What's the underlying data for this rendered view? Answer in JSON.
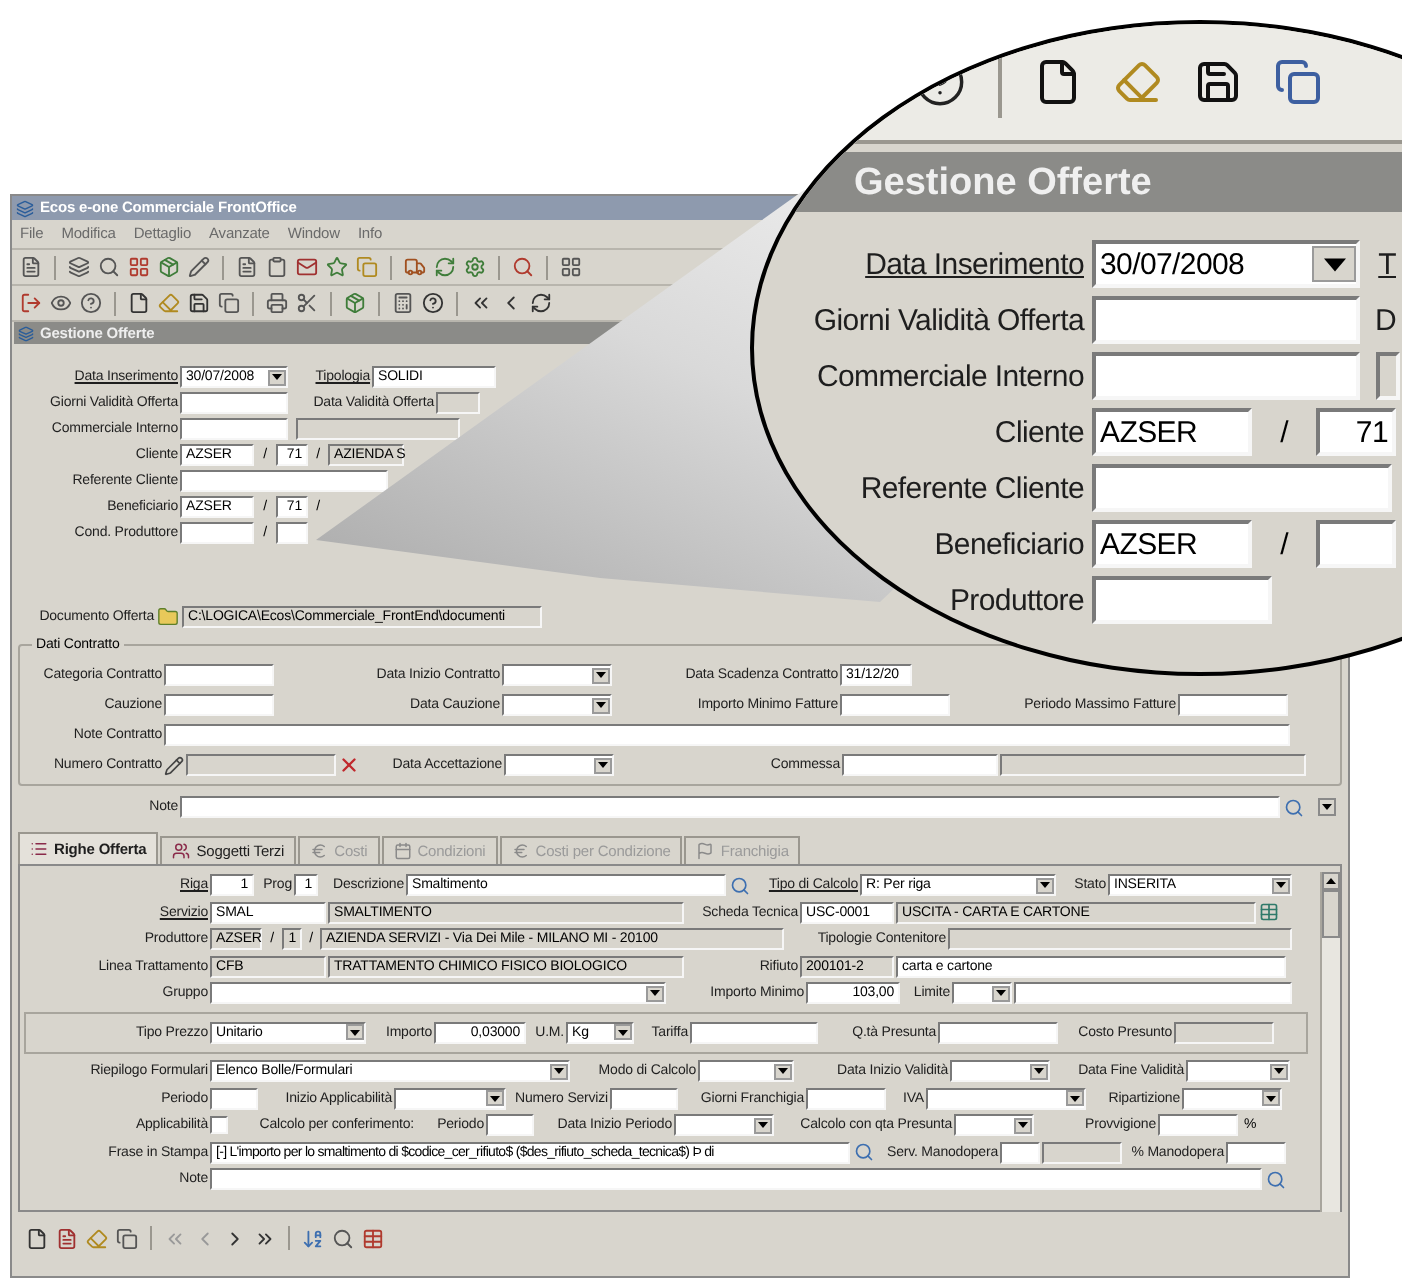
{
  "app": {
    "title": "Ecos e-one Commerciale FrontOffice",
    "menu": [
      "File",
      "Modifica",
      "Dettaglio",
      "Avanzate",
      "Window",
      "Info"
    ]
  },
  "document": {
    "title": "Gestione Offerte",
    "header_rows": [
      [
        {
          "kind": "link",
          "text": "Data Inserimento"
        },
        {
          "kind": "combo",
          "value": "30/07/2008"
        },
        {
          "kind": "link",
          "text": "Tipologia"
        },
        {
          "kind": "field",
          "value": "SOLIDI",
          "disabled": false
        }
      ],
      [
        {
          "kind": "label",
          "text": "Giorni Validità Offerta"
        },
        {
          "kind": "field",
          "disabled": false
        },
        {
          "kind": "label",
          "text": "Data Validità Offerta"
        },
        {
          "kind": "field",
          "disabled": true
        }
      ],
      [
        {
          "kind": "label",
          "text": "Commerciale Interno"
        },
        {
          "kind": "field",
          "disabled": false
        },
        {
          "kind": "field",
          "disabled": true
        }
      ],
      [
        {
          "kind": "label",
          "text": "Cliente"
        },
        {
          "kind": "field",
          "value": "AZSER",
          "disabled": false
        },
        {
          "kind": "text",
          "text": "/"
        },
        {
          "kind": "field",
          "value": "71",
          "disabled": false
        },
        {
          "kind": "text",
          "text": "/"
        },
        {
          "kind": "field",
          "value": "AZIENDA S",
          "disabled": true
        }
      ],
      [
        {
          "kind": "label",
          "text": "Referente Cliente"
        },
        {
          "kind": "field",
          "disabled": false
        }
      ],
      [
        {
          "kind": "label",
          "text": "Beneficiario"
        },
        {
          "kind": "field",
          "value": "AZSER",
          "disabled": false
        },
        {
          "kind": "text",
          "text": "/"
        },
        {
          "kind": "field",
          "value": "71",
          "disabled": false
        },
        {
          "kind": "text",
          "text": "/"
        }
      ],
      [
        {
          "kind": "label",
          "text": "Cond. Produttore"
        },
        {
          "kind": "field",
          "disabled": false
        },
        {
          "kind": "text",
          "text": "/"
        },
        {
          "kind": "field",
          "disabled": false
        }
      ]
    ],
    "document_row": [
      {
        "kind": "label",
        "text": "Documento Offerta"
      },
      {
        "kind": "folder"
      },
      {
        "kind": "field",
        "value": "C:\\LOGICA\\Ecos\\Commerciale_FrontEnd\\documenti",
        "disabled": true
      }
    ],
    "contract": {
      "title": "Dati Contratto",
      "rows": [
        [
          {
            "kind": "label",
            "text": "Categoria Contratto"
          },
          {
            "kind": "field",
            "disabled": false
          },
          {
            "kind": "label",
            "text": "Data Inizio Contratto"
          },
          {
            "kind": "combo"
          },
          {
            "kind": "label",
            "text": "Data Scadenza Contratto"
          },
          {
            "kind": "field",
            "value": "31/12/20",
            "disabled": false
          }
        ],
        [
          {
            "kind": "label",
            "text": "Cauzione"
          },
          {
            "kind": "field",
            "disabled": false
          },
          {
            "kind": "label",
            "text": "Data Cauzione"
          },
          {
            "kind": "combo"
          },
          {
            "kind": "label",
            "text": "Importo Minimo Fatture"
          },
          {
            "kind": "field",
            "disabled": false
          },
          {
            "kind": "label",
            "text": "Periodo Massimo Fatture"
          },
          {
            "kind": "field",
            "disabled": false
          }
        ],
        [
          {
            "kind": "label",
            "text": "Note Contratto"
          },
          {
            "kind": "field",
            "disabled": false
          }
        ],
        [
          {
            "kind": "label",
            "text": "Numero Contratto"
          },
          {
            "kind": "number_picker",
            "disabled": true
          },
          {
            "kind": "label",
            "text": "Data Accettazione"
          },
          {
            "kind": "combo"
          },
          {
            "kind": "label",
            "text": "Commessa"
          },
          {
            "kind": "field",
            "disabled": false
          },
          {
            "kind": "field",
            "disabled": true
          }
        ]
      ]
    },
    "note_row": [
      {
        "kind": "label",
        "text": "Note"
      },
      {
        "kind": "field",
        "disabled": false
      },
      {
        "kind": "lookup"
      }
    ]
  },
  "tabs": [
    {
      "label": "Righe Offerta",
      "selected": true,
      "disabled": false
    },
    {
      "label": "Soggetti Terzi",
      "selected": false,
      "disabled": false
    },
    {
      "label": "Costi",
      "selected": false,
      "disabled": true
    },
    {
      "label": "Condizioni",
      "selected": false,
      "disabled": true
    },
    {
      "label": "Costi per Condizione",
      "selected": false,
      "disabled": true
    },
    {
      "label": "Franchigia",
      "selected": false,
      "disabled": true
    }
  ],
  "detail": {
    "top_rows": [
      [
        {
          "kind": "link",
          "text": "Riga"
        },
        {
          "kind": "field",
          "value": "1",
          "disabled": false
        },
        {
          "kind": "label",
          "text": "Prog"
        },
        {
          "kind": "field",
          "value": "1",
          "disabled": false
        },
        {
          "kind": "label",
          "text": "Descrizione"
        },
        {
          "kind": "field",
          "value": "Smaltimento",
          "disabled": false
        },
        {
          "kind": "lookup"
        },
        {
          "kind": "link",
          "text": "Tipo di Calcolo"
        },
        {
          "kind": "combo",
          "value": "R: Per riga"
        },
        {
          "kind": "label",
          "text": "Stato"
        },
        {
          "kind": "combo",
          "value": "INSERITA"
        }
      ],
      [
        {
          "kind": "link",
          "text": "Servizio"
        },
        {
          "kind": "field",
          "value": "SMAL",
          "disabled": false
        },
        {
          "kind": "field",
          "value": "SMALTIMENTO",
          "disabled": true
        },
        {
          "kind": "label",
          "text": "Scheda Tecnica"
        },
        {
          "kind": "field",
          "value": "USC-0001",
          "disabled": false
        },
        {
          "kind": "field",
          "value": "USCITA - CARTA E CARTONE",
          "disabled": true
        },
        {
          "kind": "sheet"
        }
      ],
      [
        {
          "kind": "label",
          "text": "Produttore"
        },
        {
          "kind": "field",
          "value": "AZSER",
          "disabled": true
        },
        {
          "kind": "text",
          "text": "/"
        },
        {
          "kind": "field",
          "value": "1",
          "disabled": true
        },
        {
          "kind": "text",
          "text": "/"
        },
        {
          "kind": "field",
          "value": "AZIENDA SERVIZI - Via Dei Mile - MILANO MI - 20100",
          "disabled": true
        },
        {
          "kind": "label",
          "text": "Tipologie Contenitore"
        },
        {
          "kind": "field",
          "disabled": true
        }
      ],
      [
        {
          "kind": "label",
          "text": "Linea Trattamento"
        },
        {
          "kind": "field",
          "value": "CFB",
          "disabled": true
        },
        {
          "kind": "field",
          "value": "TRATTAMENTO CHIMICO FISICO BIOLOGICO",
          "disabled": true
        },
        {
          "kind": "label",
          "text": "Rifiuto"
        },
        {
          "kind": "field",
          "value": "200101-2",
          "disabled": true
        },
        {
          "kind": "field",
          "value": "carta e cartone",
          "disabled": false
        }
      ],
      [
        {
          "kind": "label",
          "text": "Gruppo"
        },
        {
          "kind": "combo"
        },
        {
          "kind": "label",
          "text": "Importo Minimo"
        },
        {
          "kind": "field",
          "value": "103,00",
          "disabled": false
        },
        {
          "kind": "label",
          "text": "Limite"
        },
        {
          "kind": "combo"
        },
        {
          "kind": "field",
          "disabled": false
        }
      ]
    ],
    "price_row": [
      {
        "kind": "label",
        "text": "Tipo Prezzo"
      },
      {
        "kind": "combo",
        "value": "Unitario"
      },
      {
        "kind": "label",
        "text": "Importo"
      },
      {
        "kind": "field",
        "value": "0,03000",
        "disabled": false
      },
      {
        "kind": "label",
        "text": "U.M."
      },
      {
        "kind": "combo",
        "value": "Kg"
      },
      {
        "kind": "label",
        "text": "Tariffa"
      },
      {
        "kind": "field",
        "disabled": false
      },
      {
        "kind": "label",
        "text": "Q.tà Presunta"
      },
      {
        "kind": "field",
        "disabled": false
      },
      {
        "kind": "label",
        "text": "Costo Presunto"
      },
      {
        "kind": "field",
        "disabled": true
      }
    ],
    "bottom_rows": [
      [
        {
          "kind": "label",
          "text": "Riepilogo Formulari"
        },
        {
          "kind": "combo",
          "value": "Elenco Bolle/Formulari"
        },
        {
          "kind": "label",
          "text": "Modo di Calcolo"
        },
        {
          "kind": "combo"
        },
        {
          "kind": "label",
          "text": "Data Inizio Validità"
        },
        {
          "kind": "combo"
        },
        {
          "kind": "label",
          "text": "Data Fine Validità"
        },
        {
          "kind": "combo"
        }
      ],
      [
        {
          "kind": "label",
          "text": "Periodo"
        },
        {
          "kind": "field",
          "disabled": false
        },
        {
          "kind": "label",
          "text": "Inizio Applicabilità"
        },
        {
          "kind": "combo"
        },
        {
          "kind": "label",
          "text": "Numero Servizi"
        },
        {
          "kind": "field",
          "disabled": false
        },
        {
          "kind": "label",
          "text": "Giorni Franchigia"
        },
        {
          "kind": "field",
          "disabled": false
        },
        {
          "kind": "label",
          "text": "IVA"
        },
        {
          "kind": "combo"
        },
        {
          "kind": "label",
          "text": "Ripartizione"
        },
        {
          "kind": "combo"
        }
      ],
      [
        {
          "kind": "label",
          "text": "Applicabilità"
        },
        {
          "kind": "check",
          "checked": false
        },
        {
          "kind": "label",
          "text": "Calcolo per conferimento:"
        },
        {
          "kind": "label",
          "text": "Periodo"
        },
        {
          "kind": "field",
          "disabled": false
        },
        {
          "kind": "label",
          "text": "Data Inizio Periodo"
        },
        {
          "kind": "combo"
        },
        {
          "kind": "label",
          "text": "Calcolo con qta Presunta"
        },
        {
          "kind": "combo"
        },
        {
          "kind": "label",
          "text": "Provvigione"
        },
        {
          "kind": "field",
          "disabled": false
        },
        {
          "kind": "text",
          "text": "%"
        }
      ],
      [
        {
          "kind": "label",
          "text": "Frase in Stampa"
        },
        {
          "kind": "field",
          "value": "[-] L'importo per lo smaltimento di $codice_cer_rifiuto$ ($des_rifiuto_scheda_tecnica$) Þ di",
          "disabled": false
        },
        {
          "kind": "lookup"
        },
        {
          "kind": "label",
          "text": "Serv. Manodopera"
        },
        {
          "kind": "field",
          "disabled": false
        },
        {
          "kind": "field",
          "disabled": true
        },
        {
          "kind": "label",
          "text": "% Manodopera"
        },
        {
          "kind": "field",
          "disabled": false
        }
      ],
      [
        {
          "kind": "label",
          "text": "Note"
        },
        {
          "kind": "field",
          "disabled": false
        },
        {
          "kind": "lookup"
        }
      ]
    ]
  },
  "lens": {
    "title": "Gestione Offerte",
    "rows": [
      [
        {
          "kind": "link",
          "text": "Data Inserimento"
        },
        {
          "kind": "combo",
          "value": "30/07/2008"
        },
        {
          "kind": "link",
          "text": "T"
        }
      ],
      [
        {
          "kind": "label",
          "text": "Giorni Validità Offerta"
        },
        {
          "kind": "field",
          "disabled": false
        },
        {
          "kind": "label",
          "text": "D"
        }
      ],
      [
        {
          "kind": "label",
          "text": "Commerciale Interno"
        },
        {
          "kind": "field",
          "disabled": false
        },
        {
          "kind": "field",
          "disabled": true
        }
      ],
      [
        {
          "kind": "label",
          "text": "Cliente"
        },
        {
          "kind": "field",
          "value": "AZSER",
          "disabled": false
        },
        {
          "kind": "text",
          "text": "/"
        },
        {
          "kind": "field",
          "value": "71",
          "disabled": false
        }
      ],
      [
        {
          "kind": "label",
          "text": "Referente Cliente"
        },
        {
          "kind": "field",
          "disabled": false
        }
      ],
      [
        {
          "kind": "label",
          "text": "Beneficiario"
        },
        {
          "kind": "field",
          "value": "AZSER",
          "disabled": false
        },
        {
          "kind": "text",
          "text": "/"
        },
        {
          "kind": "field",
          "disabled": false
        }
      ],
      [
        {
          "kind": "label",
          "text": "Produttore"
        },
        {
          "kind": "field",
          "disabled": false
        }
      ]
    ]
  }
}
